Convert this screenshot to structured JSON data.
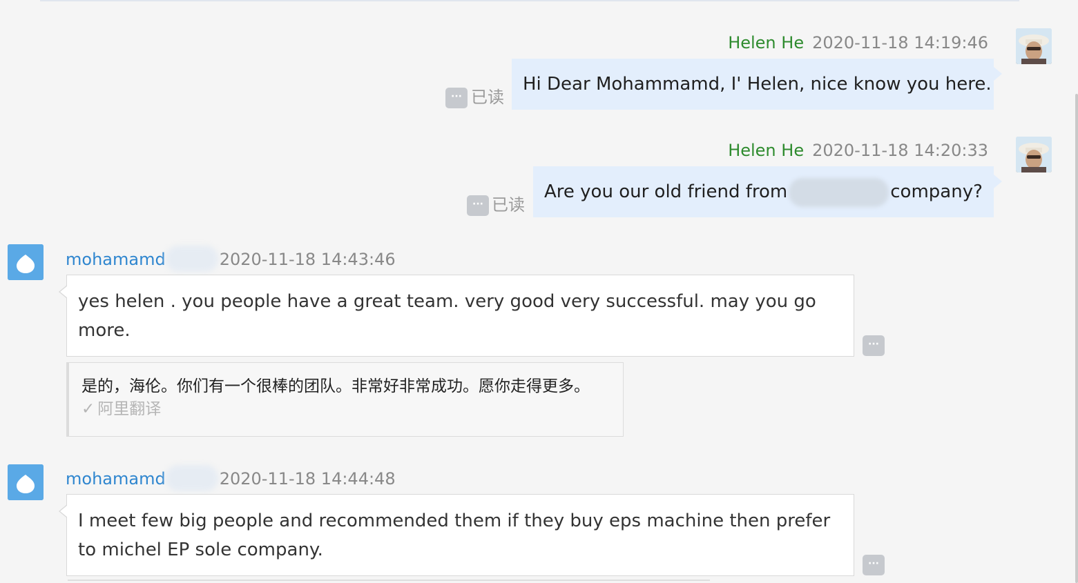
{
  "chat": {
    "read_label": "已读",
    "more_glyph": "···",
    "messages": [
      {
        "sender": "Helen He",
        "time": "2020-11-18 14:19:46",
        "text": "Hi Dear Mohammamd, I' Helen, nice know you here."
      },
      {
        "sender": "Helen He",
        "time": "2020-11-18 14:20:33",
        "text_before": "Are you our old friend from",
        "text_after": "company?"
      },
      {
        "sender": "mohamamd",
        "time": "2020-11-18 14:43:46",
        "text": "yes helen . you people have a great team. very good very successful. may you go more.",
        "translation": {
          "text": "是的，海伦。你们有一个很棒的团队。非常好非常成功。愿你走得更多。",
          "source": "阿里翻译"
        }
      },
      {
        "sender": "mohamamd",
        "time": "2020-11-18 14:44:48",
        "text": "I meet few big people and recommended them if they buy eps machine then prefer to michel EP sole company."
      }
    ]
  },
  "colors": {
    "self_name": "#2e8b2e",
    "other_name": "#2f86cf",
    "self_bubble": "#e3eefc",
    "other_bubble": "#ffffff",
    "background": "#f5f5f5"
  }
}
